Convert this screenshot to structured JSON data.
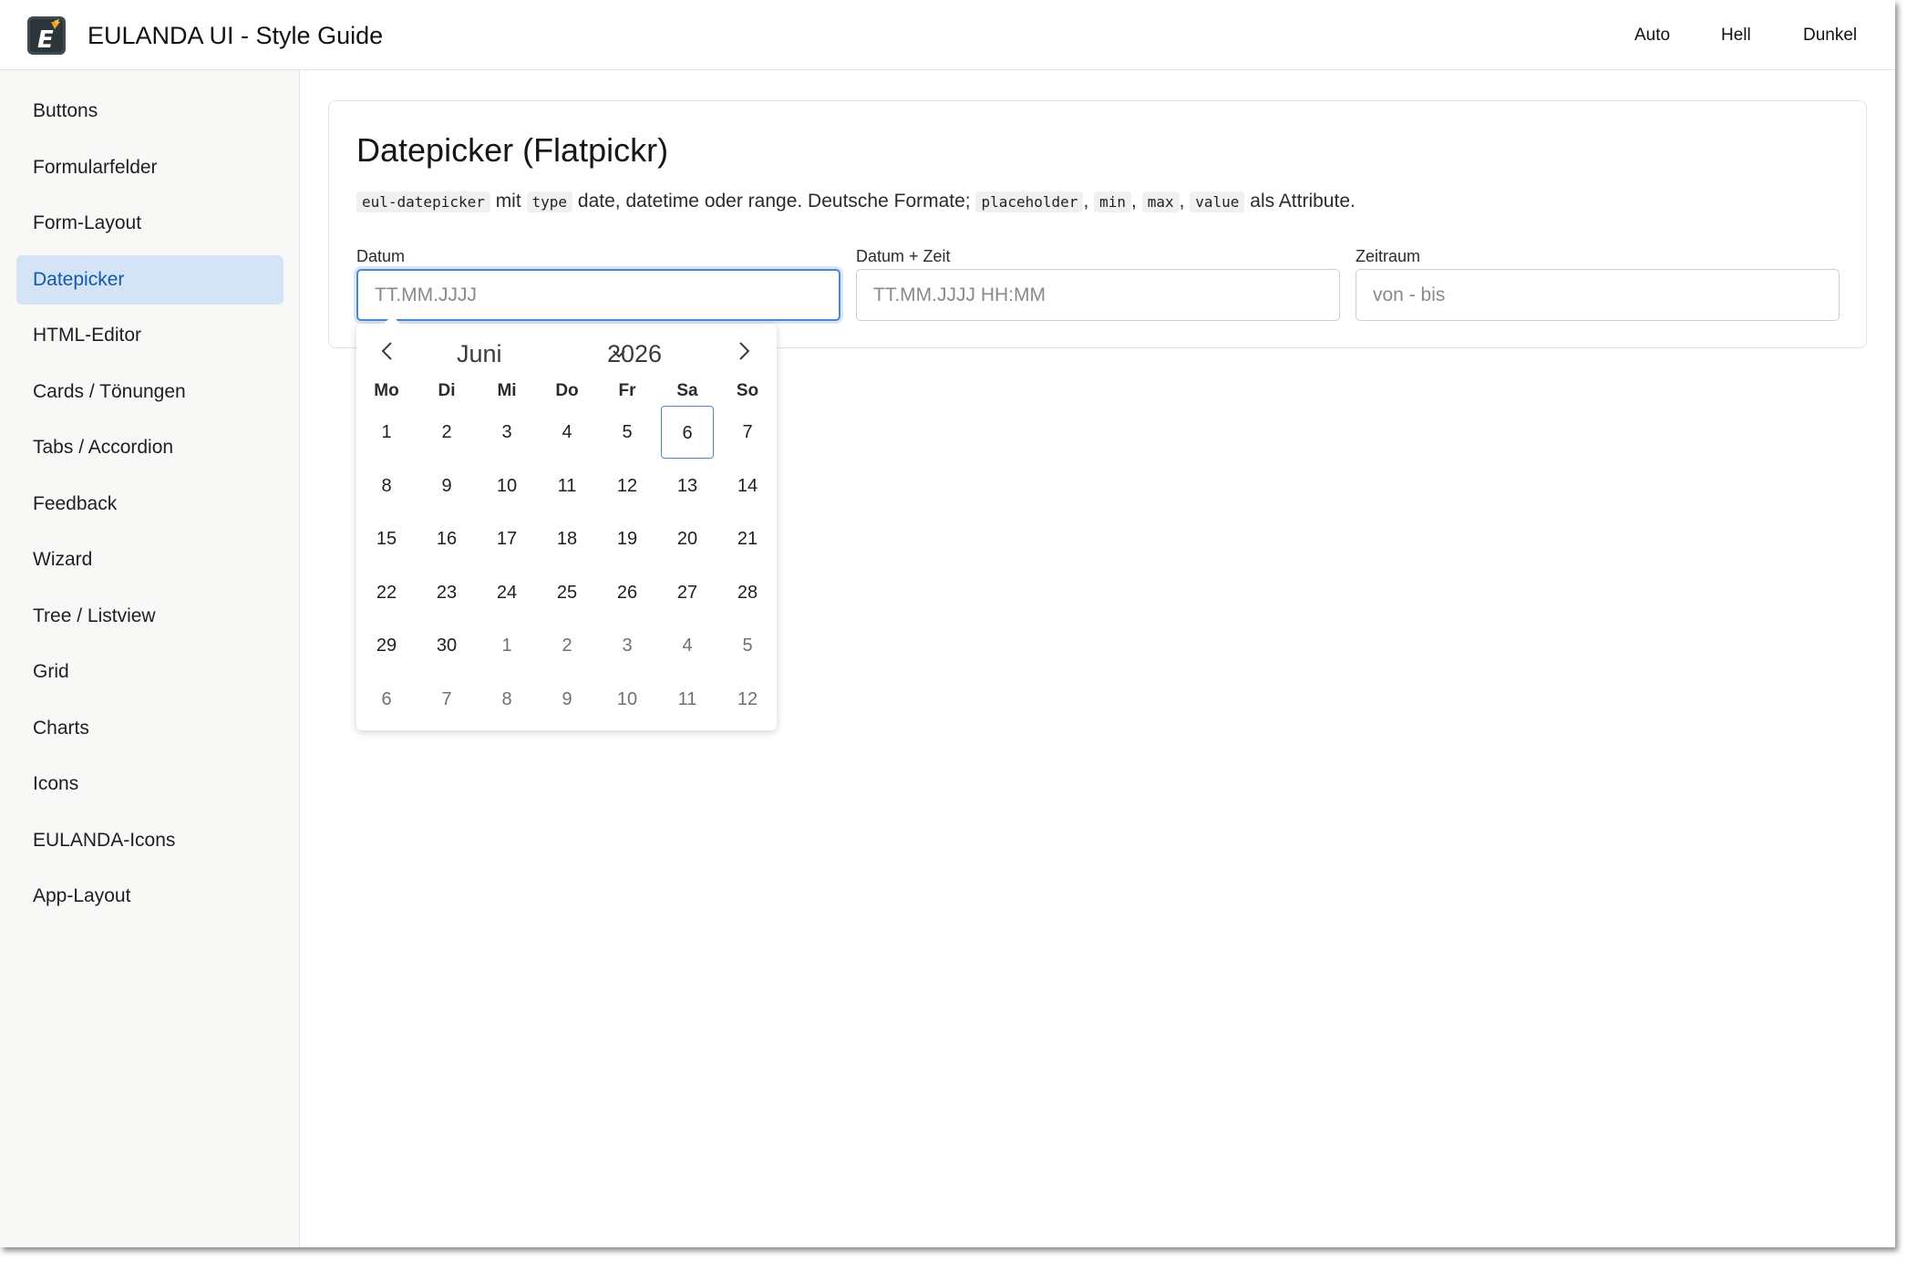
{
  "header": {
    "title": "EULANDA UI - Style Guide",
    "logo_letter": "E",
    "theme_buttons": [
      "Auto",
      "Hell",
      "Dunkel"
    ]
  },
  "sidebar": {
    "items": [
      {
        "label": "Buttons"
      },
      {
        "label": "Formularfelder"
      },
      {
        "label": "Form-Layout"
      },
      {
        "label": "Datepicker",
        "active": true
      },
      {
        "label": "HTML-Editor"
      },
      {
        "label": "Cards / Tönungen"
      },
      {
        "label": "Tabs / Accordion"
      },
      {
        "label": "Feedback"
      },
      {
        "label": "Wizard"
      },
      {
        "label": "Tree / Listview"
      },
      {
        "label": "Grid"
      },
      {
        "label": "Charts"
      },
      {
        "label": "Icons"
      },
      {
        "label": "EULANDA-Icons"
      },
      {
        "label": "App-Layout"
      }
    ]
  },
  "main": {
    "title": "Datepicker (Flatpickr)",
    "description": {
      "code1": "eul-datepicker",
      "t1": " mit ",
      "code2": "type",
      "t2": " date, datetime oder range. Deutsche Formate; ",
      "code3": "placeholder",
      "t3": ", ",
      "code4": "min",
      "t4": ", ",
      "code5": "max",
      "t5": ", ",
      "code6": "value",
      "t6": " als Attribute."
    },
    "fields": [
      {
        "label": "Datum",
        "placeholder": "TT.MM.JJJJ",
        "value": ""
      },
      {
        "label": "Datum + Zeit",
        "placeholder": "TT.MM.JJJJ HH:MM",
        "value": ""
      },
      {
        "label": "Zeitraum",
        "placeholder": "von - bis",
        "value": ""
      }
    ]
  },
  "calendar": {
    "month": "Juni",
    "year": "2026",
    "weekdays": [
      "Mo",
      "Di",
      "Mi",
      "Do",
      "Fr",
      "Sa",
      "So"
    ],
    "today": "6",
    "weeks": [
      [
        {
          "d": "1"
        },
        {
          "d": "2"
        },
        {
          "d": "3"
        },
        {
          "d": "4"
        },
        {
          "d": "5"
        },
        {
          "d": "6",
          "today": true
        },
        {
          "d": "7"
        }
      ],
      [
        {
          "d": "8"
        },
        {
          "d": "9"
        },
        {
          "d": "10"
        },
        {
          "d": "11"
        },
        {
          "d": "12"
        },
        {
          "d": "13"
        },
        {
          "d": "14"
        }
      ],
      [
        {
          "d": "15"
        },
        {
          "d": "16"
        },
        {
          "d": "17"
        },
        {
          "d": "18"
        },
        {
          "d": "19"
        },
        {
          "d": "20"
        },
        {
          "d": "21"
        }
      ],
      [
        {
          "d": "22"
        },
        {
          "d": "23"
        },
        {
          "d": "24"
        },
        {
          "d": "25"
        },
        {
          "d": "26"
        },
        {
          "d": "27"
        },
        {
          "d": "28"
        }
      ],
      [
        {
          "d": "29"
        },
        {
          "d": "30"
        },
        {
          "d": "1",
          "other": true
        },
        {
          "d": "2",
          "other": true
        },
        {
          "d": "3",
          "other": true
        },
        {
          "d": "4",
          "other": true
        },
        {
          "d": "5",
          "other": true
        }
      ],
      [
        {
          "d": "6",
          "other": true
        },
        {
          "d": "7",
          "other": true
        },
        {
          "d": "8",
          "other": true
        },
        {
          "d": "9",
          "other": true
        },
        {
          "d": "10",
          "other": true
        },
        {
          "d": "11",
          "other": true
        },
        {
          "d": "12",
          "other": true
        }
      ]
    ]
  },
  "colors": {
    "accent": "#4a88d6",
    "active_nav_bg": "#d4e4f6",
    "active_nav_text": "#1259a8",
    "logo_bg": "#3e4a4f",
    "logo_accent": "#f0a21a"
  }
}
